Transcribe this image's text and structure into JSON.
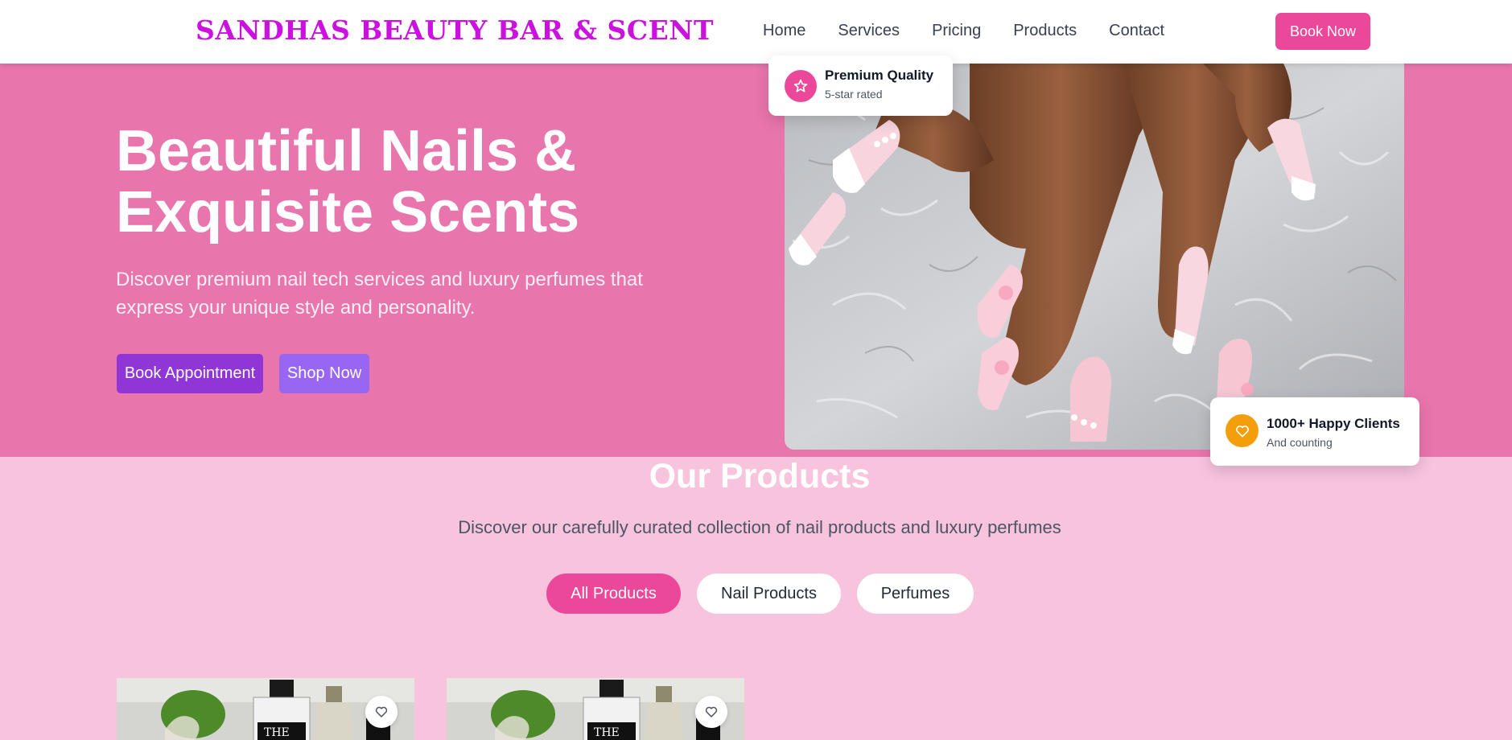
{
  "header": {
    "brand": "SANDHAS BEAUTY BAR & SCENT",
    "nav": [
      "Home",
      "Services",
      "Pricing",
      "Products",
      "Contact"
    ],
    "book_label": "Book Now"
  },
  "hero": {
    "title_line1": "Beautiful Nails &",
    "title_line2": "Exquisite Scents",
    "subtitle": "Discover premium nail tech services and luxury perfumes that express your unique style and personality.",
    "primary_button": "Book Appointment",
    "secondary_button": "Shop Now",
    "image_icon": "manicured-hands-photo",
    "badge_quality": {
      "title": "Premium Quality",
      "sub": "5-star rated",
      "icon": "star-icon",
      "color": "#ec4899"
    },
    "badge_clients": {
      "title": "1000+ Happy Clients",
      "sub": "And counting",
      "icon": "heart-icon",
      "color": "#f59e0b"
    }
  },
  "products": {
    "title": "Our Products",
    "subtitle": "Discover our carefully curated collection of nail products and luxury perfumes",
    "filters": [
      "All Products",
      "Nail Products",
      "Perfumes"
    ],
    "active_filter": "All Products",
    "card_image_icon": "perfume-bottles-photo",
    "favorite_icon": "heart-icon"
  },
  "colors": {
    "brand": "#cc10e0",
    "accent": "#ec4899",
    "hero_bg": "#e875ac",
    "page_bg": "#f7c3dd",
    "primary_btn": "#9036d6",
    "secondary_btn": "#9966f4"
  }
}
